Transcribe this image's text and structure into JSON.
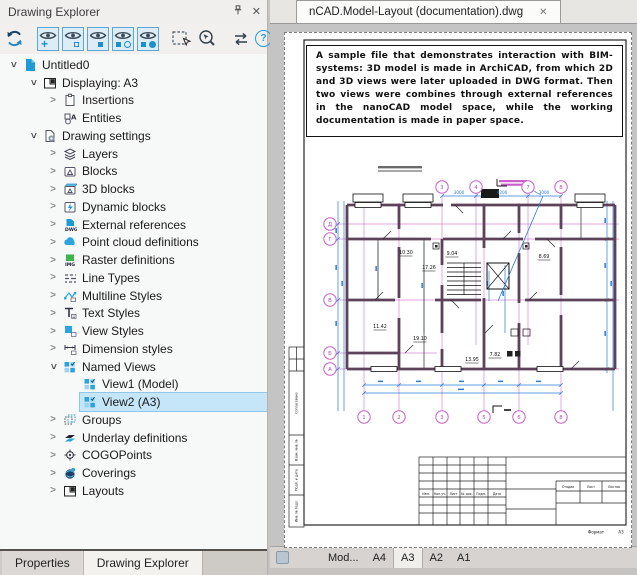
{
  "panel": {
    "title": "Drawing Explorer",
    "toolbar_icons": [
      "refresh",
      "eye-plus",
      "eye-square",
      "eye-filled-square",
      "eye-circle",
      "eye-solid-circle",
      "select-rectangle",
      "zoom-select",
      "swap",
      "help"
    ]
  },
  "tree": {
    "items": [
      {
        "label": "Untitled0",
        "level": 0,
        "chevron": "expanded",
        "icon": "file"
      },
      {
        "label": "Displaying: A3",
        "level": 1,
        "chevron": "expanded",
        "icon": "layout"
      },
      {
        "label": "Insertions",
        "level": 2,
        "chevron": "collapsed",
        "icon": "insertions"
      },
      {
        "label": "Entities",
        "level": 2,
        "chevron": "none",
        "icon": "entities"
      },
      {
        "label": "Drawing settings",
        "level": 1,
        "chevron": "expanded",
        "icon": "settings"
      },
      {
        "label": "Layers",
        "level": 2,
        "chevron": "collapsed",
        "icon": "layers"
      },
      {
        "label": "Blocks",
        "level": 2,
        "chevron": "collapsed",
        "icon": "blocks"
      },
      {
        "label": "3D blocks",
        "level": 2,
        "chevron": "collapsed",
        "icon": "blocks3d"
      },
      {
        "label": "Dynamic blocks",
        "level": 2,
        "chevron": "collapsed",
        "icon": "dynblocks"
      },
      {
        "label": "External references",
        "level": 2,
        "chevron": "collapsed",
        "icon": "dwg"
      },
      {
        "label": "Point cloud definitions",
        "level": 2,
        "chevron": "collapsed",
        "icon": "cloud"
      },
      {
        "label": "Raster definitions",
        "level": 2,
        "chevron": "collapsed",
        "icon": "img"
      },
      {
        "label": "Line Types",
        "level": 2,
        "chevron": "collapsed",
        "icon": "linetypes"
      },
      {
        "label": "Multiline Styles",
        "level": 2,
        "chevron": "collapsed",
        "icon": "multiline"
      },
      {
        "label": "Text Styles",
        "level": 2,
        "chevron": "collapsed",
        "icon": "textstyles"
      },
      {
        "label": "View Styles",
        "level": 2,
        "chevron": "collapsed",
        "icon": "viewstyles"
      },
      {
        "label": "Dimension styles",
        "level": 2,
        "chevron": "collapsed",
        "icon": "dimstyles"
      },
      {
        "label": "Named Views",
        "level": 2,
        "chevron": "expanded",
        "icon": "namedviews"
      },
      {
        "label": "View1 (Model)",
        "level": 3,
        "chevron": "none",
        "icon": "view"
      },
      {
        "label": "View2 (A3)",
        "level": 3,
        "chevron": "none",
        "icon": "view",
        "selected": true
      },
      {
        "label": "Groups",
        "level": 2,
        "chevron": "collapsed",
        "icon": "groups"
      },
      {
        "label": "Underlay definitions",
        "level": 2,
        "chevron": "collapsed",
        "icon": "underlay"
      },
      {
        "label": "COGOPoints",
        "level": 2,
        "chevron": "collapsed",
        "icon": "cogo"
      },
      {
        "label": "Coverings",
        "level": 2,
        "chevron": "collapsed",
        "icon": "coverings"
      },
      {
        "label": "Layouts",
        "level": 2,
        "chevron": "collapsed",
        "icon": "layouts"
      }
    ]
  },
  "bottom_tabs": {
    "items": [
      "Properties",
      "Drawing Explorer"
    ],
    "active": "Drawing Explorer"
  },
  "document": {
    "tab": {
      "title": "nCAD.Model-Layout (documentation).dwg",
      "close": "✕"
    },
    "note_text": "A sample file that demonstrates interaction with BIM-systems: 3D model is made in ArchiCAD, from which 2D and 3D views were later uploaded in DWG format. Then two views were combines through external references in the nanoCAD model space, while the working documentation is made in paper space.",
    "plan": {
      "top_axes": [
        "3",
        "4",
        "7",
        "8"
      ],
      "left_axes": [
        "Д",
        "Г",
        "В",
        "Б",
        "А"
      ],
      "bottom_axes": [
        "1",
        "2",
        "3",
        "5",
        "6",
        "8"
      ],
      "top_dims": [
        "3000",
        "4200",
        "3000"
      ],
      "room_areas": [
        "10.30",
        "9.04",
        "17.26",
        "8.69",
        "11.42",
        "19.10",
        "13.95",
        "7.82"
      ]
    },
    "title_block": {
      "header_cells": [
        "Изм.",
        "Кол.уч.",
        "Лист",
        "№ док.",
        "Подп.",
        "Дата"
      ],
      "stage_cells": [
        "Стадия",
        "Лист",
        "Листов"
      ],
      "format_label": "Формат",
      "format_value": "A3",
      "side_labels": [
        "Согласовано",
        "Взам. инв. №",
        "Подп. и дата",
        "Инв. № подл."
      ]
    },
    "sheet_tabs": {
      "items": [
        "Mod...",
        "A4",
        "A3",
        "A2",
        "A1"
      ],
      "active": "A3"
    }
  }
}
